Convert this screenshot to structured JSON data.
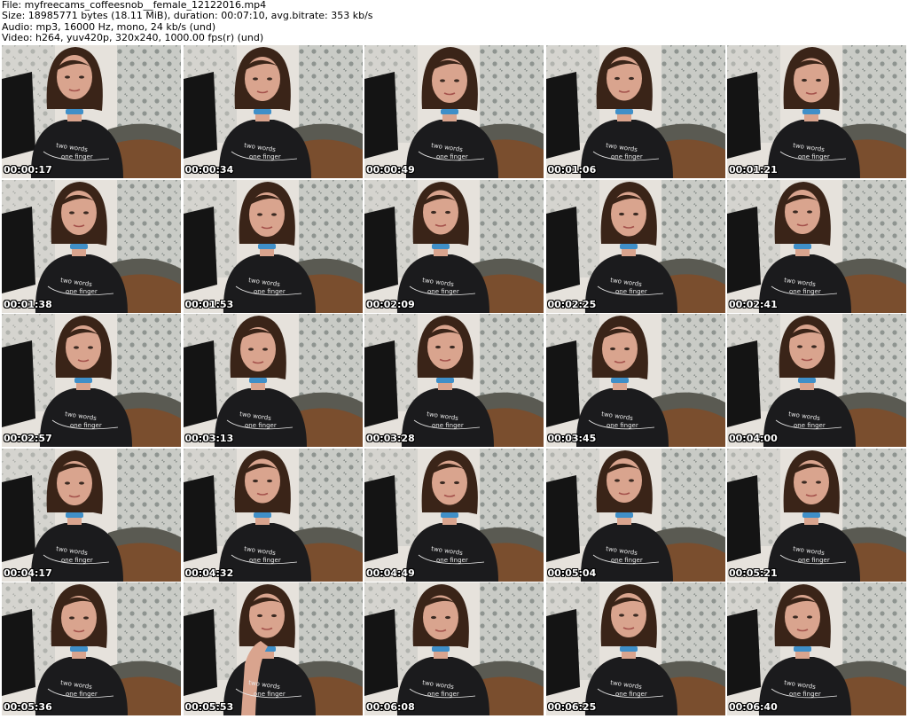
{
  "header": {
    "file_line": "File: myfreecams_coffeesnob__female_12122016.mp4",
    "size_line": "Size: 18985771 bytes (18.11 MiB), duration: 00:07:10, avg.bitrate: 353 kb/s",
    "audio_line": "Audio: mp3, 16000 Hz, mono, 24 kb/s (und)",
    "video_line": "Video: h264, yuv420p, 320x240, 1000.00 fps(r) (und)"
  },
  "thumbnails": [
    {
      "timestamp": "00:00:17"
    },
    {
      "timestamp": "00:00:34"
    },
    {
      "timestamp": "00:00:49"
    },
    {
      "timestamp": "00:01:06"
    },
    {
      "timestamp": "00:01:21"
    },
    {
      "timestamp": "00:01:38"
    },
    {
      "timestamp": "00:01:53"
    },
    {
      "timestamp": "00:02:09"
    },
    {
      "timestamp": "00:02:25"
    },
    {
      "timestamp": "00:02:41"
    },
    {
      "timestamp": "00:02:57"
    },
    {
      "timestamp": "00:03:13"
    },
    {
      "timestamp": "00:03:28"
    },
    {
      "timestamp": "00:03:45"
    },
    {
      "timestamp": "00:04:00"
    },
    {
      "timestamp": "00:04:17"
    },
    {
      "timestamp": "00:04:32"
    },
    {
      "timestamp": "00:04:49"
    },
    {
      "timestamp": "00:05:04"
    },
    {
      "timestamp": "00:05:21"
    },
    {
      "timestamp": "00:05:36"
    },
    {
      "timestamp": "00:05:53"
    },
    {
      "timestamp": "00:06:08"
    },
    {
      "timestamp": "00:06:25"
    },
    {
      "timestamp": "00:06:40"
    }
  ],
  "shirt_text": [
    "two words",
    "one finger"
  ],
  "colors": {
    "wall": "#c9cbc6",
    "wallpaper_pattern": "#8e9490",
    "monitor": "#141414",
    "couch": "#7a4e2e",
    "shirt": "#1b1b1d",
    "hair": "#3a2418",
    "skin": "#d9a48e",
    "choker": "#3f8fc8"
  }
}
